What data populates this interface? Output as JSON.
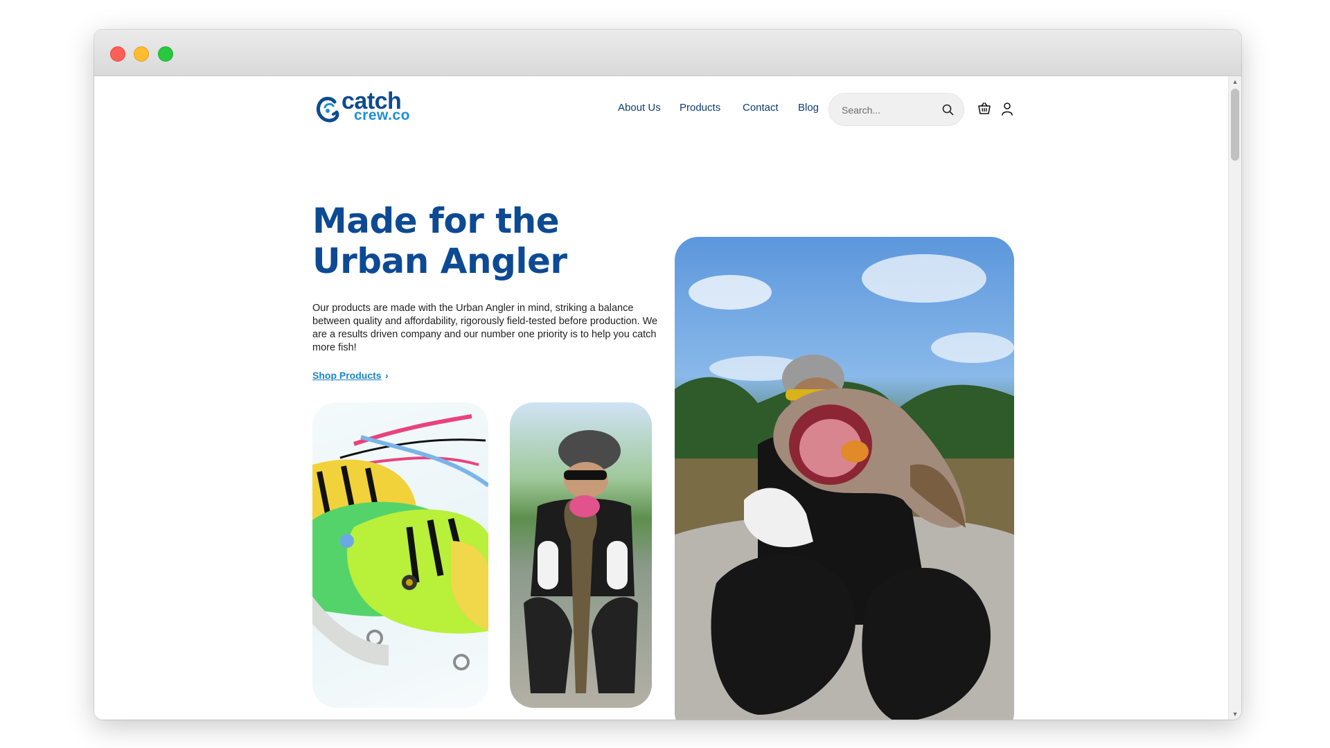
{
  "brand": {
    "logo_top": "catch",
    "logo_bottom": "crew.co"
  },
  "nav": {
    "items": [
      {
        "label": "About Us"
      },
      {
        "label": "Products"
      },
      {
        "label": "Contact"
      },
      {
        "label": "Blog"
      }
    ],
    "search_placeholder": "Search..."
  },
  "hero": {
    "title": "Made for the Urban Angler",
    "body": "Our products are made with the Urban Angler in mind, striking a balance between quality and affordability, rigorously field-tested before production. We are a results driven company and our number one priority is to help you catch more fish!",
    "cta_label": "Shop Products",
    "cta_chevron": "›"
  },
  "icons": {
    "search": "search-icon",
    "cart": "basket-icon",
    "account": "user-icon",
    "cta": "chevron-right-icon"
  },
  "colors": {
    "brand_navy": "#0d4a93",
    "brand_blue": "#1b8fd6",
    "nav_text": "#0d3c72",
    "link": "#1a84c9"
  }
}
